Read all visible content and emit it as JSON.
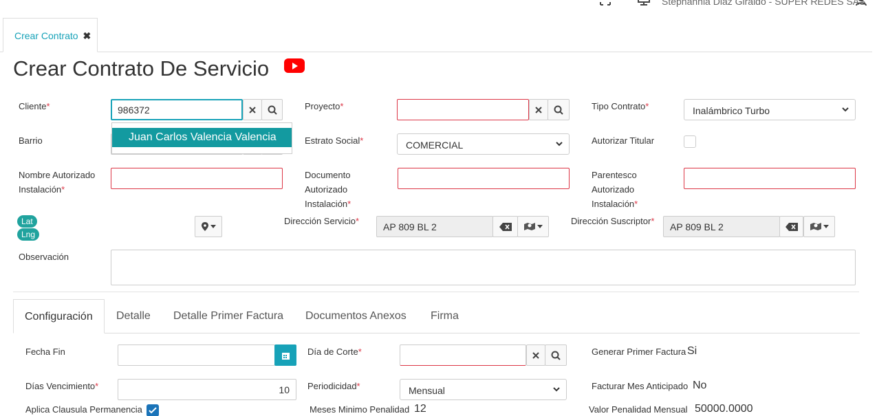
{
  "header": {
    "user": "Stephannia Diaz Giraldo - SUPER REDES SAS",
    "icons": [
      "fullscreen-icon",
      "monitor-icon",
      "user-icon"
    ]
  },
  "page_tab": {
    "label": "Crear Contrato",
    "close": "✖"
  },
  "title": "Crear Contrato De Servicio",
  "form": {
    "cliente": {
      "label": "Cliente",
      "value": "986372"
    },
    "cliente_suggestion": "Juan Carlos Valencia Valencia",
    "proyecto": {
      "label": "Proyecto",
      "value": ""
    },
    "tipo_contrato": {
      "label": "Tipo Contrato",
      "selected": "Inalámbrico Turbo"
    },
    "barrio": {
      "label": "Barrio"
    },
    "estrato_social": {
      "label": "Estrato Social",
      "selected": "COMERCIAL"
    },
    "autorizar_titular": {
      "label": "Autorizar Titular",
      "checked": false
    },
    "nombre_autorizado": {
      "label_1": "Nombre Autorizado",
      "label_2": "Instalación",
      "value": ""
    },
    "documento_autorizado": {
      "label_1": "Documento",
      "label_2": "Autorizado",
      "label_3": "Instalación",
      "value": ""
    },
    "parentesco_autorizado": {
      "label_1": "Parentesco",
      "label_2": "Autorizado",
      "label_3": "Instalación",
      "value": ""
    },
    "lat": "Lat",
    "lng": "Lng",
    "direccion_servicio": {
      "label": "Dirección Servicio",
      "value": "AP 809 BL 2"
    },
    "direccion_suscriptor": {
      "label": "Dirección Suscriptor",
      "value": "AP 809 BL 2"
    },
    "observacion": {
      "label": "Observación",
      "value": ""
    },
    "required_mark": "*"
  },
  "tabs": [
    "Configuración",
    "Detalle",
    "Detalle Primer Factura",
    "Documentos Anexos",
    "Firma"
  ],
  "config": {
    "fecha_fin": {
      "label": "Fecha Fin",
      "value": ""
    },
    "dia_corte": {
      "label": "Día de Corte",
      "value": ""
    },
    "generar_primer_factura": {
      "label": "Generar Primer Factura",
      "value": "Si"
    },
    "dias_vencimiento": {
      "label": "Días Vencimiento",
      "value": "10"
    },
    "periodicidad": {
      "label": "Periodicidad",
      "selected": "Mensual"
    },
    "facturar_mes_anticipado": {
      "label": "Facturar Mes Anticipado",
      "value": "No"
    },
    "aplica_clausula": {
      "label": "Aplica Clausula Permanencia",
      "checked": true
    },
    "meses_minimo": {
      "label": "Meses Minimo Penalidad",
      "value": "12"
    },
    "valor_penalidad": {
      "label": "Valor Penalidad Mensual",
      "value": "50000.0000"
    }
  }
}
